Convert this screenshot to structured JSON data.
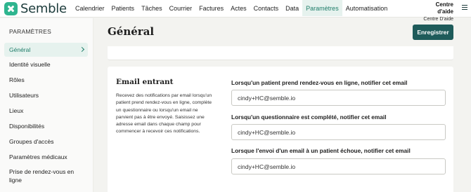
{
  "brand": {
    "name": "Semble"
  },
  "nav": {
    "items": [
      {
        "label": "Calendrier"
      },
      {
        "label": "Patients"
      },
      {
        "label": "Tâches"
      },
      {
        "label": "Courrier"
      },
      {
        "label": "Factures"
      },
      {
        "label": "Actes"
      },
      {
        "label": "Contacts"
      },
      {
        "label": "Data"
      },
      {
        "label": "Paramètres",
        "active": true
      },
      {
        "label": "Automatisation"
      }
    ]
  },
  "help": {
    "title": "Centre d'aide",
    "subtitle": "Centre D'aide"
  },
  "sidebar": {
    "heading": "PARAMÈTRES",
    "items": [
      {
        "label": "Général",
        "active": true
      },
      {
        "label": "Identité visuelle"
      },
      {
        "label": "Rôles"
      },
      {
        "label": "Utilisateurs"
      },
      {
        "label": "Lieux"
      },
      {
        "label": "Disponibilités"
      },
      {
        "label": "Groupes d'accès"
      },
      {
        "label": "Paramètres médicaux"
      },
      {
        "label": "Prise de rendez-vous en ligne"
      }
    ]
  },
  "main": {
    "title": "Général",
    "save_label": "Enregistrer"
  },
  "email_section": {
    "title": "Email entrant",
    "description": "Recevez des notifications par email lorsqu'un patient prend rendez-vous en ligne, complète un questionnaire ou lorsqu'un email ne parvient pas à être envoyé. Saisissez une adresse email dans chaque champ pour commencer à recevoir ces notifications.",
    "fields": [
      {
        "label": "Lorsqu'un patient prend rendez-vous en ligne, notifier cet email",
        "value": "cindy+HC@semble.io"
      },
      {
        "label": "Lorsqu'un questionnaire est complété, notifier cet email",
        "value": "cindy+HC@semble.io"
      },
      {
        "label": "Lorsque l'envoi d'un email à un patient échoue, notifier cet email",
        "value": "cindy+HC@semble.io"
      }
    ]
  },
  "colors": {
    "accent": "#1e5b5a",
    "brand": "#2fb58f",
    "active_bg": "#e6f2ee"
  }
}
